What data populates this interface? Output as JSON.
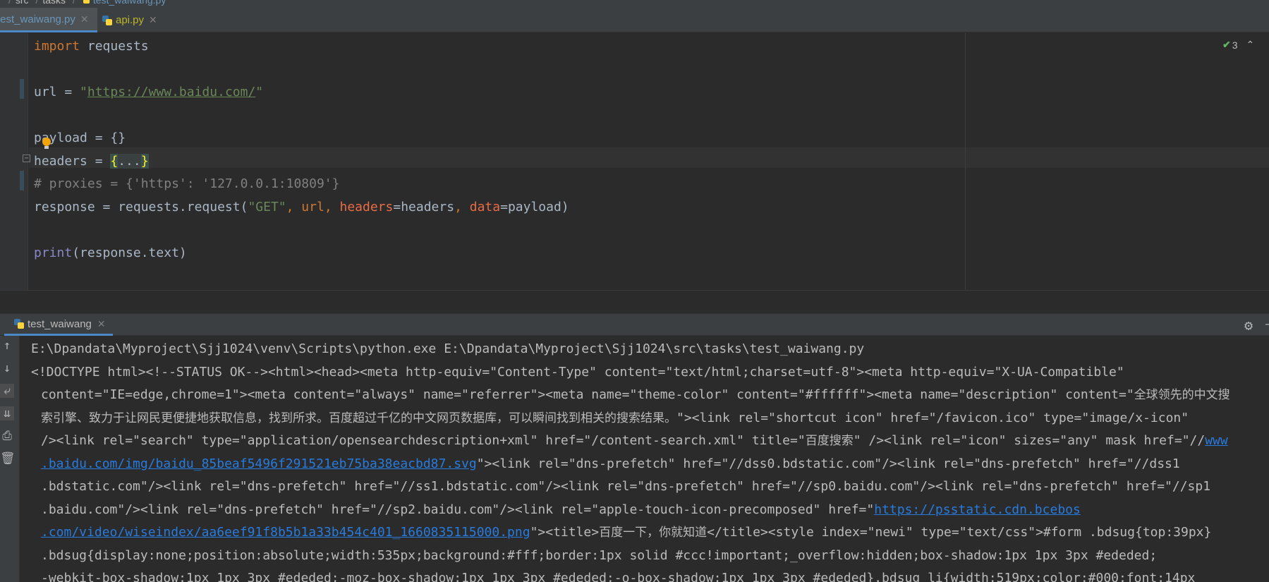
{
  "breadcrumb": {
    "items": [
      "src",
      "tasks"
    ],
    "file": "test_waiwang.py"
  },
  "tabs": [
    {
      "label": "test_waiwang.py",
      "active": true
    },
    {
      "label": "api.py",
      "active": false
    }
  ],
  "editor": {
    "inspection_count": "3",
    "code": {
      "import_kw": "import",
      "import_mod": " requests",
      "url_var": "url = ",
      "url_quote_open": "\"",
      "url_value": "https://www.baidu.com/",
      "url_quote_close": "\"",
      "payload_line": "payload = {}",
      "headers_prefix": "headers = ",
      "headers_open": "{",
      "headers_collapsed": "...",
      "headers_close": "}",
      "proxies_comment": "# proxies = {'https': '127.0.0.1:10809'}",
      "resp_prefix": "response = requests.request(",
      "resp_get": "\"GET\"",
      "resp_comma1": ", url",
      "resp_comma2": ", ",
      "resp_headers_kw": "headers",
      "resp_headers_val": "=headers",
      "resp_comma3": ", ",
      "resp_data_kw": "data",
      "resp_data_val": "=payload)",
      "print_fn": "print",
      "print_args": "(response.text)"
    }
  },
  "run": {
    "tab_label": "test_waiwang",
    "command": "E:\\Dpandata\\Myproject\\Sjj1024\\venv\\Scripts\\python.exe E:\\Dpandata\\Myproject\\Sjj1024\\src\\tasks\\test_waiwang.py",
    "l2": "<!DOCTYPE html><!--STATUS OK--><html><head><meta http-equiv=\"Content-Type\" content=\"text/html;charset=utf-8\"><meta http-equiv=\"X-UA-Compatible\"",
    "l3a": "content=\"IE=edge,chrome=1\"><meta content=\"always\" name=\"referrer\"><meta name=\"theme-color\" content=\"#ffffff\"><meta name=\"description\" content=\"",
    "l3b": "全球领先的中文搜",
    "l4a": "索引擎、致力于让网民更便捷地获取信息，找到所求。百度超过千亿的中文网页数据库，可以瞬间找到相关的搜索结果。",
    "l4b": "\"><link rel=\"shortcut icon\" href=\"/favicon.ico\" type=\"image/x-icon\"",
    "l5a": "/><link rel=\"search\" type=\"application/opensearchdescription+xml\" href=\"/content-search.xml\" title=\"",
    "l5b": "百度搜索",
    "l5c": "\" /><link rel=\"icon\" sizes=\"any\" mask href=\"//",
    "l5d": "www",
    "l6a": ".baidu.com/img/baidu_85beaf5496f291521eb75ba38eacbd87.svg",
    "l6b": "\"><link rel=\"dns-prefetch\" href=\"//dss0.bdstatic.com\"/><link rel=\"dns-prefetch\" href=\"//dss1",
    "l7": ".bdstatic.com\"/><link rel=\"dns-prefetch\" href=\"//ss1.bdstatic.com\"/><link rel=\"dns-prefetch\" href=\"//sp0.baidu.com\"/><link rel=\"dns-prefetch\" href=\"//sp1",
    "l8a": ".baidu.com\"/><link rel=\"dns-prefetch\" href=\"//sp2.baidu.com\"/><link rel=\"apple-touch-icon-precomposed\" href=\"",
    "l8b": "https://psstatic.cdn.bcebos",
    "l9a": ".com/video/wiseindex/aa6eef91f8b5b1a33b454c401_1660835115000.png",
    "l9b": "\"><title>",
    "l9c": "百度一下，你就知道",
    "l9d": "</title><style index=\"newi\" type=\"text/css\">#form .bdsug{top:39px}",
    "l10": ".bdsug{display:none;position:absolute;width:535px;background:#fff;border:1px solid #ccc!important;_overflow:hidden;box-shadow:1px 1px 3px #ededed;",
    "l11": "-webkit-box-shadow:1px 1px 3px #ededed;-moz-box-shadow:1px 1px 3px #ededed;-o-box-shadow:1px 1px 3px #ededed}.bdsug li{width:519px;color:#000;font:14px"
  },
  "colors": {
    "keyword": "#cc7832",
    "string": "#6a8759",
    "comment": "#808080",
    "param": "#e86c45",
    "link": "#287bde",
    "accent": "#4a88c7"
  }
}
